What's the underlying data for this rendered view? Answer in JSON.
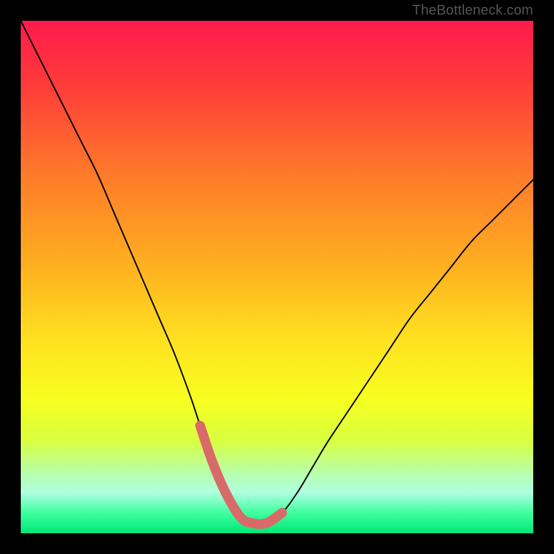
{
  "watermark": {
    "text": "TheBottleneck.com"
  },
  "colors": {
    "frame": "#000000",
    "curve_stroke": "#000000",
    "highlight_stroke": "#d96a6a",
    "gradient_stops": [
      {
        "offset": 0.0,
        "color": "#ff1a4d"
      },
      {
        "offset": 0.12,
        "color": "#ff3a3a"
      },
      {
        "offset": 0.3,
        "color": "#ff7a2a"
      },
      {
        "offset": 0.48,
        "color": "#ffb020"
      },
      {
        "offset": 0.62,
        "color": "#ffe020"
      },
      {
        "offset": 0.74,
        "color": "#f7ff20"
      },
      {
        "offset": 0.82,
        "color": "#d8ff40"
      },
      {
        "offset": 0.88,
        "color": "#b8ffa8"
      },
      {
        "offset": 0.92,
        "color": "#b0ffe0"
      },
      {
        "offset": 0.96,
        "color": "#40ffa0"
      },
      {
        "offset": 1.0,
        "color": "#00e878"
      }
    ]
  },
  "chart_data": {
    "type": "line",
    "title": "",
    "xlabel": "",
    "ylabel": "",
    "xlim": [
      0,
      100
    ],
    "ylim": [
      0,
      100
    ],
    "grid": false,
    "legend": false,
    "series": [
      {
        "name": "bottleneck-curve",
        "x": [
          0,
          3,
          6,
          9,
          12,
          15,
          18,
          21,
          24,
          27,
          30,
          33,
          35,
          37,
          39,
          41,
          43,
          45,
          48,
          51,
          54,
          57,
          60,
          64,
          68,
          72,
          76,
          80,
          84,
          88,
          92,
          96,
          100
        ],
        "y": [
          100,
          94,
          88,
          82,
          76,
          70,
          63,
          56,
          49,
          42,
          35,
          27,
          21,
          15,
          10,
          6,
          3,
          2,
          2,
          4,
          8,
          13,
          18,
          24,
          30,
          36,
          42,
          47,
          52,
          57,
          61,
          65,
          69
        ]
      }
    ],
    "highlight": {
      "name": "optimal-range",
      "x": [
        35,
        37,
        39,
        41,
        43,
        45,
        48,
        51
      ],
      "y": [
        21,
        15,
        10,
        6,
        3,
        2,
        2,
        4
      ]
    }
  }
}
